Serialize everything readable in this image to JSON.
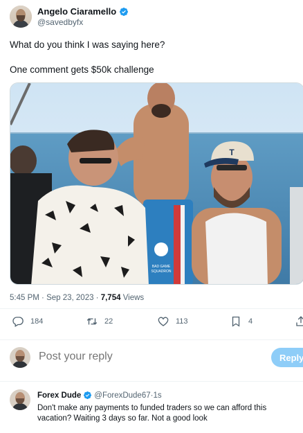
{
  "author": {
    "display_name": "Angelo Ciaramello",
    "handle": "@savedbyfx"
  },
  "tweet": {
    "line1": "What do you think I was saying here?",
    "line2": "One comment gets $50k challenge"
  },
  "media": {
    "hat_logo": "T",
    "shorts_text_1": "BAD GAME",
    "shorts_text_2": "SQUADRON"
  },
  "meta": {
    "time": "5:45 PM",
    "sep1": " · ",
    "date": "Sep 23, 2023",
    "sep2": " · ",
    "views_count": "7,754",
    "views_label": " Views"
  },
  "actions": {
    "replies": "184",
    "retweets": "22",
    "likes": "113",
    "bookmarks": "4"
  },
  "reply_box": {
    "placeholder": "Post your reply",
    "button_label": "Reply"
  },
  "comment": {
    "name": "Forex Dude",
    "handle": "@ForexDude67",
    "sep": " · ",
    "time": "1s",
    "text": "Don't make any payments to funded traders so we can afford this vacation? Waiting 3 days so far. Not a good look"
  },
  "colors": {
    "verified": "#1d9bf0",
    "reply_button": "#8ecdf8",
    "muted": "#536471"
  }
}
